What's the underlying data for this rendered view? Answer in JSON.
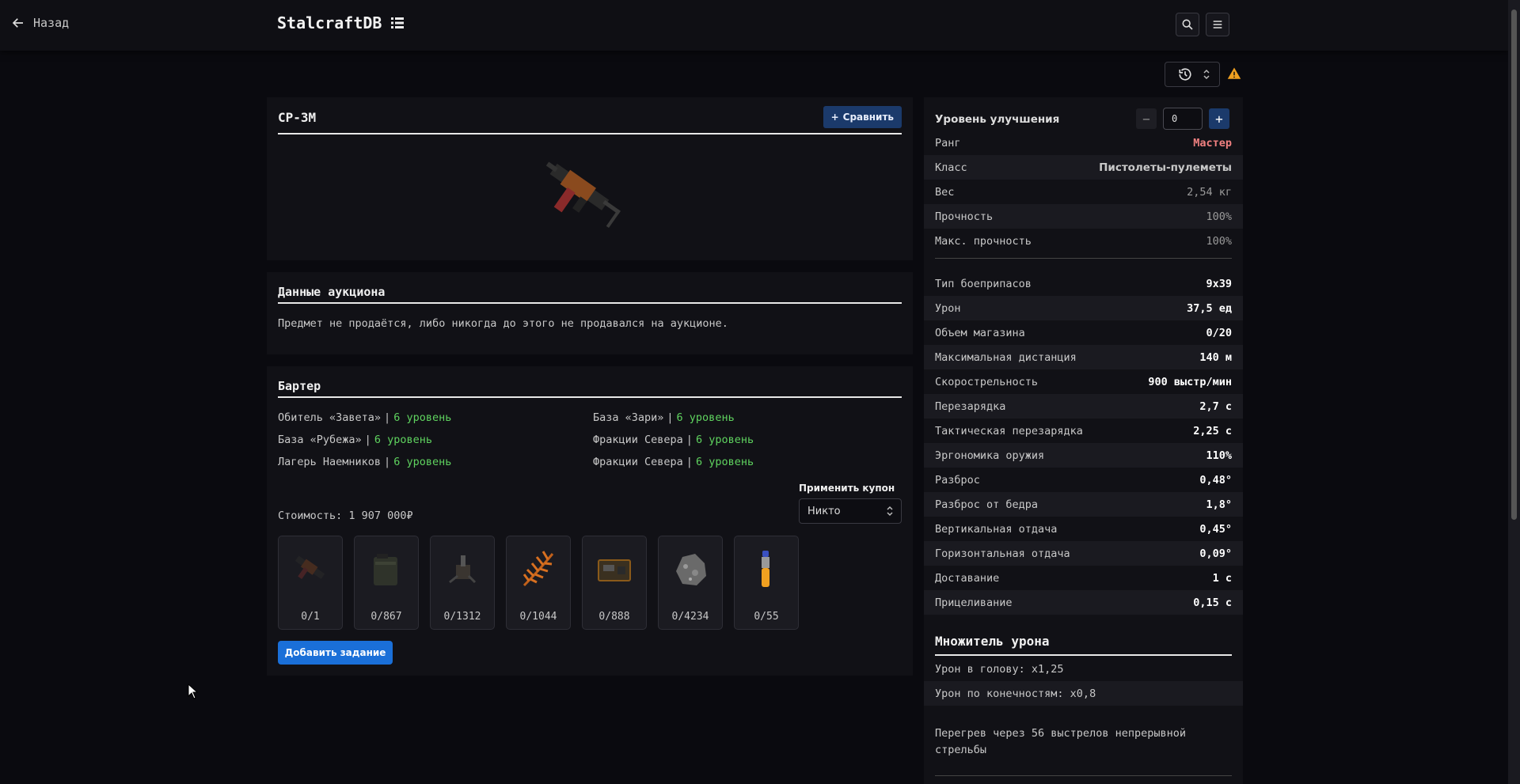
{
  "topbar": {
    "back_label": "Назад",
    "brand": "StalcraftDB"
  },
  "item": {
    "name": "СР-3М",
    "compare_label": "Сравнить"
  },
  "auction": {
    "title": "Данные аукциона",
    "text": "Предмет не продаётся, либо никогда до этого не продавался на аукционе."
  },
  "barter": {
    "title": "Бартер",
    "locations": [
      {
        "place": "Обитель «Завета»",
        "level": "6 уровень"
      },
      {
        "place": "База «Зари»",
        "level": "6 уровень"
      },
      {
        "place": "База «Рубежа»",
        "level": "6 уровень"
      },
      {
        "place": "Фракции Севера",
        "level": "6 уровень"
      },
      {
        "place": "Лагерь Наемников",
        "level": "6 уровень"
      },
      {
        "place": "Фракции Севера",
        "level": "6 уровень"
      }
    ],
    "cost": "Стоимость: 1 907 000₽",
    "coupon_label": "Применить купон",
    "coupon_value": "Никто",
    "items": [
      {
        "icon": "smg-icon",
        "count": "0/1"
      },
      {
        "icon": "ammo-box-icon",
        "count": "0/867"
      },
      {
        "icon": "device-icon",
        "count": "0/1312"
      },
      {
        "icon": "fern-icon",
        "count": "0/1044"
      },
      {
        "icon": "circuit-board-icon",
        "count": "0/888"
      },
      {
        "icon": "ore-icon",
        "count": "0/4234"
      },
      {
        "icon": "syringe-icon",
        "count": "0/55"
      }
    ],
    "add_task_label": "Добавить задание"
  },
  "stats": {
    "upgrade_label": "Уровень улучшения",
    "upgrade_value": "0",
    "rows": [
      {
        "label": "Ранг",
        "value": "Мастер"
      },
      {
        "label": "Класс",
        "value": "Пистолеты-пулеметы"
      },
      {
        "label": "Вес",
        "value": "2,54 кг"
      },
      {
        "label": "Прочность",
        "value": "100%"
      },
      {
        "label": "Макс. прочность",
        "value": "100%"
      },
      {
        "label": "Тип боеприпасов",
        "value": "9x39"
      },
      {
        "label": "Урон",
        "value": "37,5 ед"
      },
      {
        "label": "Объем магазина",
        "value": "0/20"
      },
      {
        "label": "Максимальная дистанция",
        "value": "140 м"
      },
      {
        "label": "Скорострельность",
        "value": "900 выстр/мин"
      },
      {
        "label": "Перезарядка",
        "value": "2,7 с"
      },
      {
        "label": "Тактическая перезарядка",
        "value": "2,25 с"
      },
      {
        "label": "Эргономика оружия",
        "value": "110%"
      },
      {
        "label": "Разброс",
        "value": "0,48°"
      },
      {
        "label": "Разброс от бедра",
        "value": "1,8°"
      },
      {
        "label": "Вертикальная отдача",
        "value": "0,45°"
      },
      {
        "label": "Горизонтальная отдача",
        "value": "0,09°"
      },
      {
        "label": "Доставание",
        "value": "1 с"
      },
      {
        "label": "Прицеливание",
        "value": "0,15 с"
      }
    ],
    "damage_title": "Множитель урона",
    "head": "Урон в голову: x1,25",
    "limbs": "Урон по конечностям: x0,8",
    "overheat": "Перегрев через 56 выстрелов непрерывной стрельбы"
  },
  "colors": {
    "accent": "#1a6fd8",
    "compare_bg": "#1b3a6b",
    "level_green": "#5fd35f",
    "rank": "#f08080",
    "warning": "#f0a020"
  }
}
